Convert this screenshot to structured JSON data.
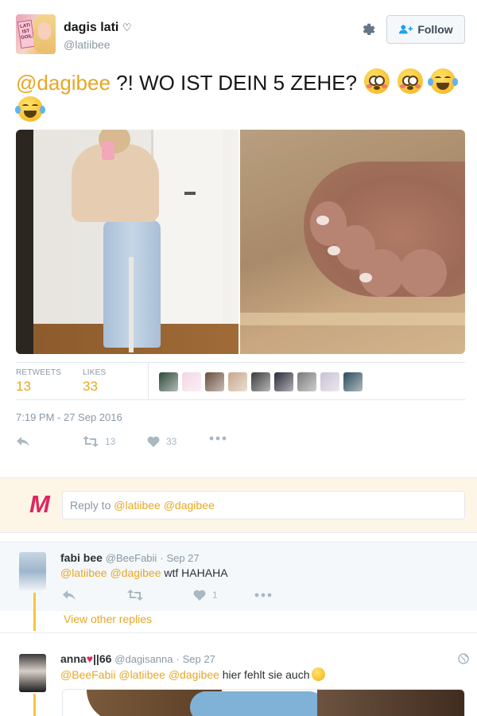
{
  "tweet": {
    "author_name": "dagis lati",
    "author_badge": "♡",
    "author_handle": "@latiibee",
    "avatar_sign_text": "LATI IST GOIL",
    "follow_label": "Follow",
    "text_mention": "@dagibee",
    "text_body": " ?! WO IST DEIN 5 ZEHE? ",
    "emojis": [
      "flushed-face",
      "flushed-face",
      "face-with-tears-of-joy",
      "face-with-tears-of-joy"
    ],
    "retweets_label": "RETWEETS",
    "retweets_count": "13",
    "likes_label": "LIKES",
    "likes_count": "33",
    "liker_avatar_colors": [
      "#2d4a3a",
      "#f4d6e6",
      "#6b4e3d",
      "#c8a68a",
      "#3b3b3b",
      "#2b2b3a",
      "#7a7a7a",
      "#c9c1d4",
      "#2b4a5a"
    ],
    "timestamp": "7:19 PM - 27 Sep 2016",
    "action_retweet_count": "13",
    "action_like_count": "33"
  },
  "reply_box": {
    "logo": "M",
    "prefix": "Reply to ",
    "mentions": "@latiibee @dagibee"
  },
  "replies": [
    {
      "name": "fabi bee",
      "handle": "@BeeFabii",
      "date": "Sep 27",
      "mentions": "@latiibee @dagibee",
      "text": " wtf HAHAHA",
      "like_count": "1"
    },
    {
      "name": "anna",
      "name_suffix": "||66",
      "handle": "@dagisanna",
      "date": "Sep 27",
      "mentions": "@BeeFabii @latiibee @dagibee",
      "text": " hier fehlt sie auch"
    }
  ],
  "view_other_replies": "View other replies",
  "colors": {
    "accent": "#e8a724",
    "muted": "#8899a6",
    "reply_bar_bg": "#fdf6e6",
    "thread_line": "#f5c542",
    "logo_magenta": "#e0245e"
  }
}
